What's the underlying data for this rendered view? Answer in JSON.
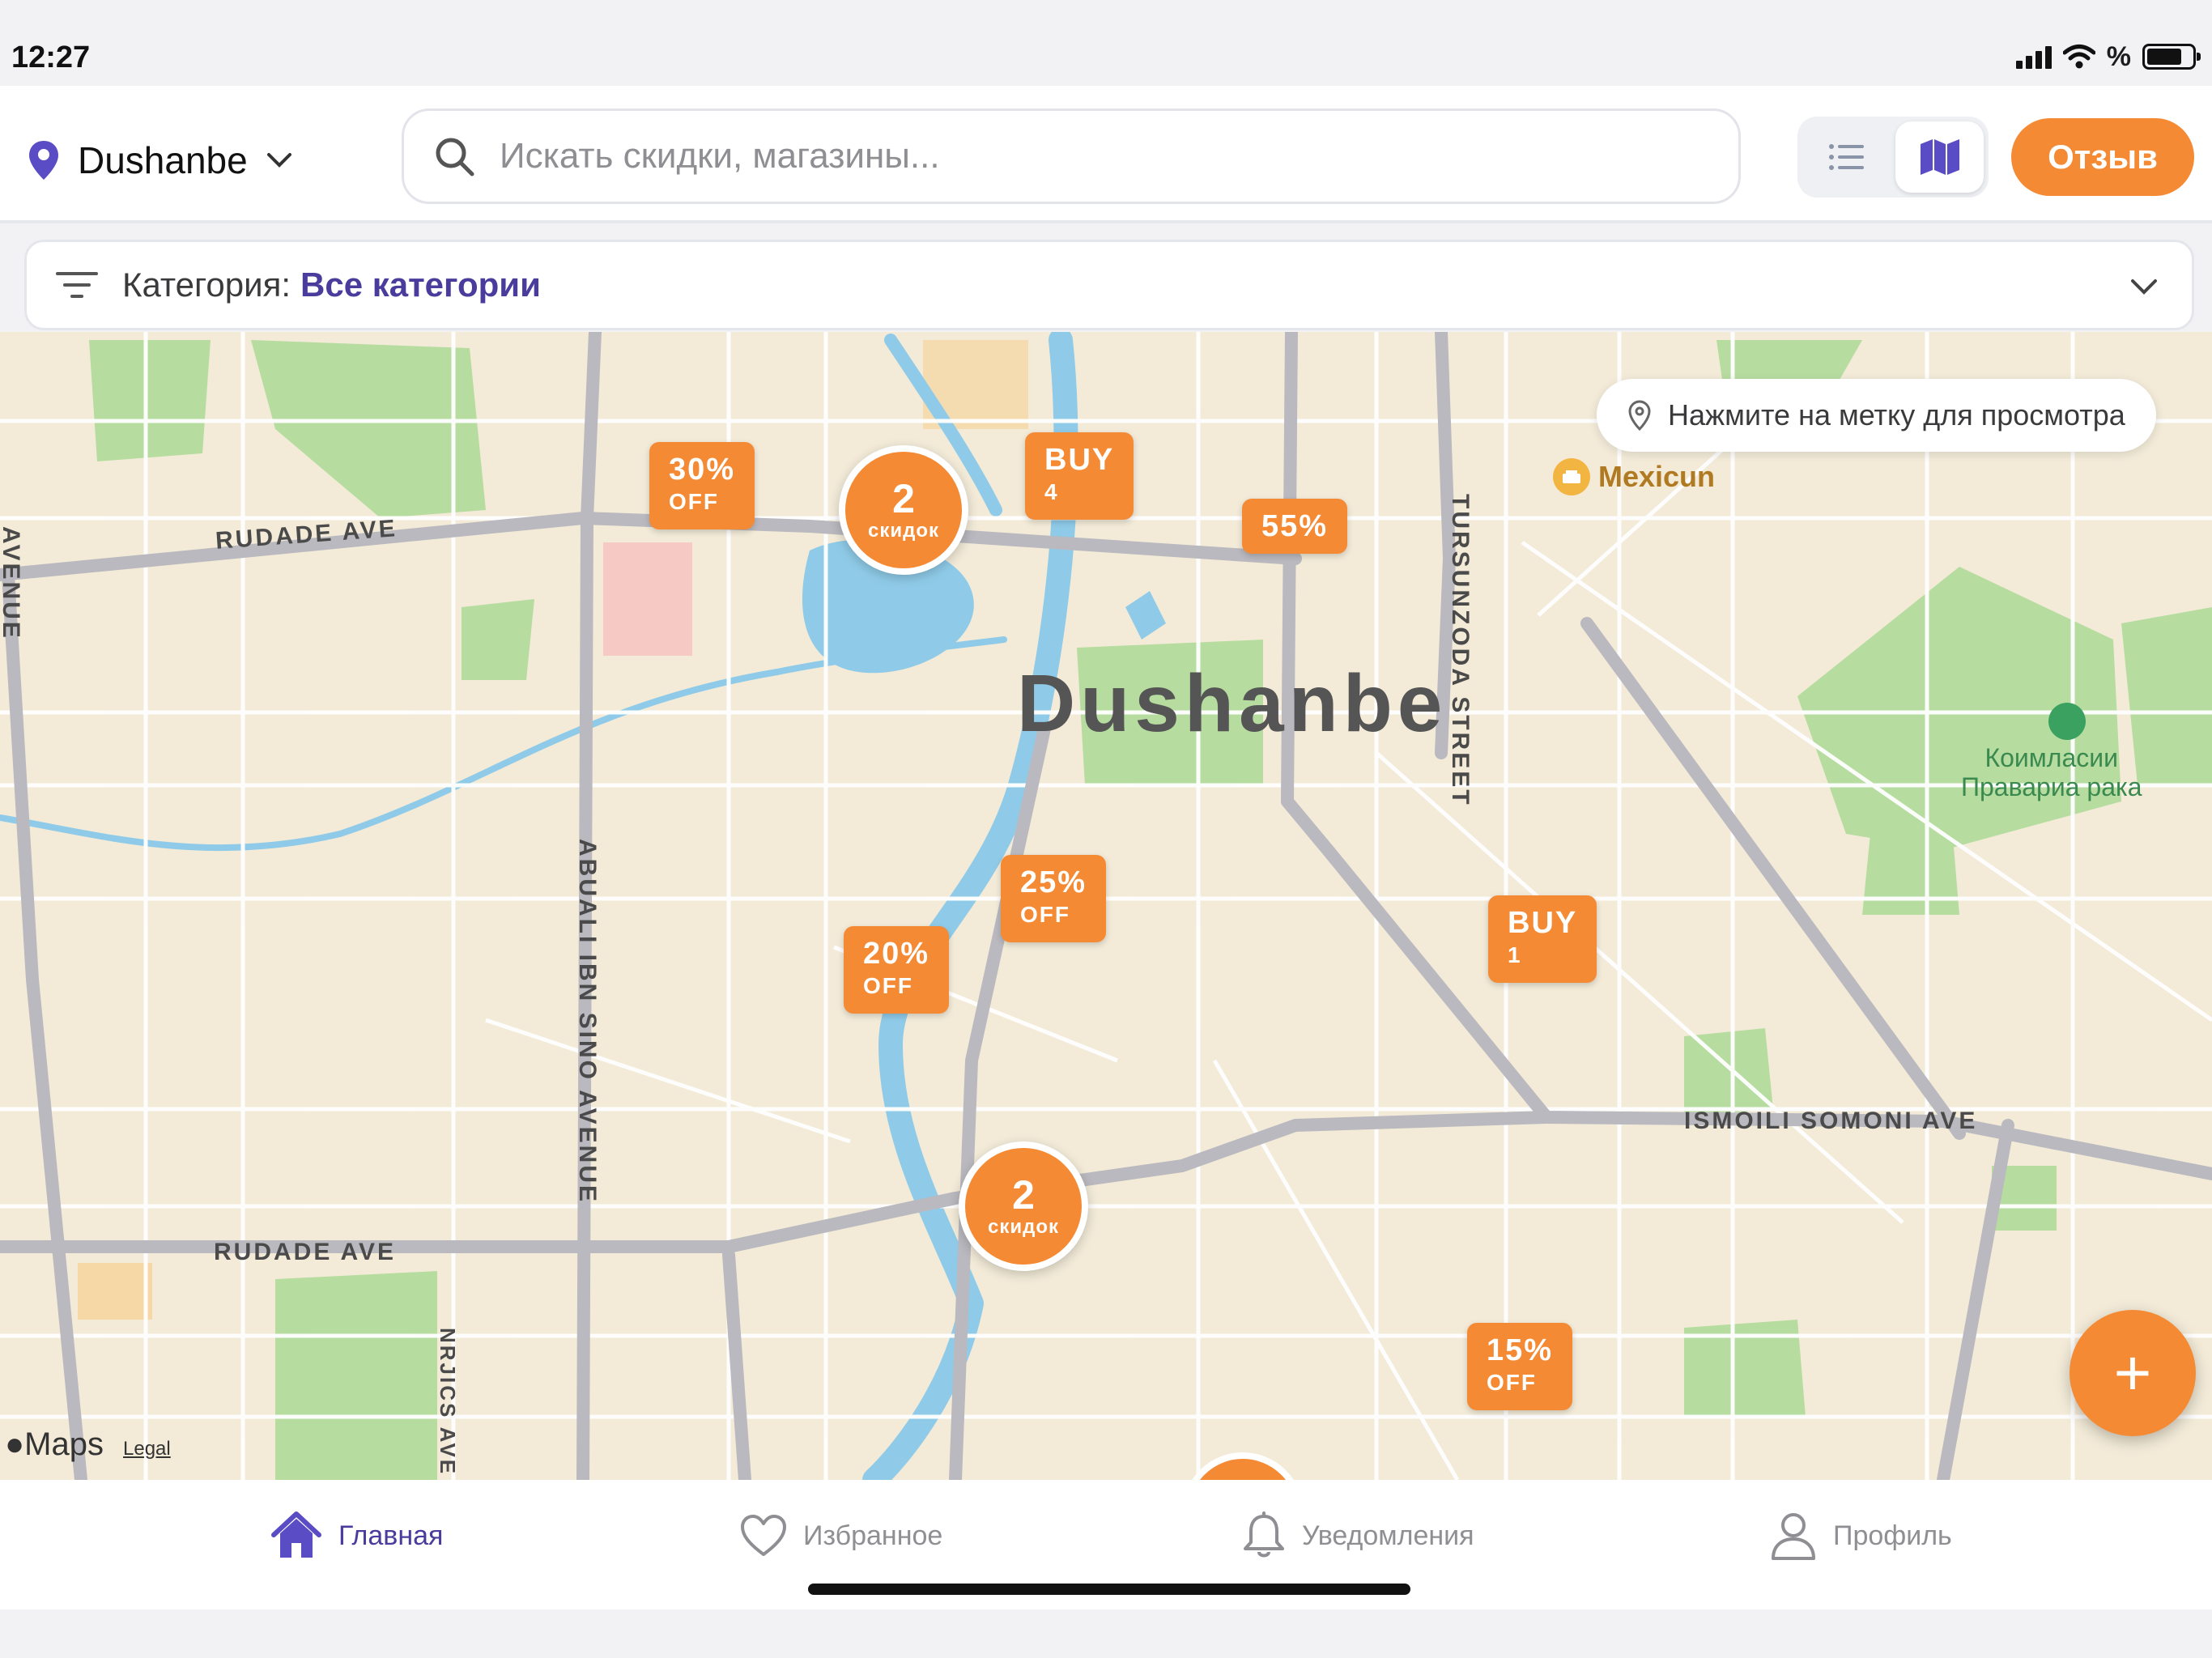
{
  "status": {
    "time": "12:27",
    "battery_text": "%"
  },
  "header": {
    "city": "Dushanbe",
    "search_placeholder": "Искать скидки, магазины...",
    "feedback_label": "Отзыв",
    "active_view": "map"
  },
  "category": {
    "label": "Категория:",
    "value": "Все категории"
  },
  "map": {
    "hint": "Нажмите на метку для просмотра",
    "city_label": "Dushanbe",
    "poi": "Mexicun",
    "park": [
      "Коимласии",
      "Правариа рака"
    ],
    "streets": {
      "rudade_top": "RUDADE AVE",
      "rudade_bottom": "RUDADE AVE",
      "tursunzoda": "TURSUNZODA STREET",
      "abuali": "ABUALI IBN SINO AVENUE",
      "ismoili": "ISMOILI SOMONI AVE",
      "avenue_left": "AVENUE",
      "aic_ave": "NRJICS AVE"
    },
    "tags": [
      {
        "line1": "30%",
        "line2": "OFF"
      },
      {
        "line1": "BUY",
        "line2": "4"
      },
      {
        "line1": "55%",
        "line2": ""
      },
      {
        "line1": "25%",
        "line2": "OFF"
      },
      {
        "line1": "20%",
        "line2": "OFF"
      },
      {
        "line1": "BUY",
        "line2": "1"
      },
      {
        "line1": "15%",
        "line2": "OFF"
      }
    ],
    "clusters": [
      {
        "count": "2",
        "unit": "скидок"
      },
      {
        "count": "2",
        "unit": "скидок"
      }
    ],
    "attribution": "Maps",
    "legal": "Legal",
    "fab_symbol": "+"
  },
  "tabs": [
    {
      "label": "Главная",
      "active": true
    },
    {
      "label": "Избранное",
      "active": false
    },
    {
      "label": "Уведомления",
      "active": false
    },
    {
      "label": "Профиль",
      "active": false
    }
  ],
  "colors": {
    "accent": "#f58a34",
    "primary": "#4a3c9c",
    "map_bg": "#f3ebd8",
    "park": "#b7dca0",
    "water": "#8fcbe8"
  }
}
